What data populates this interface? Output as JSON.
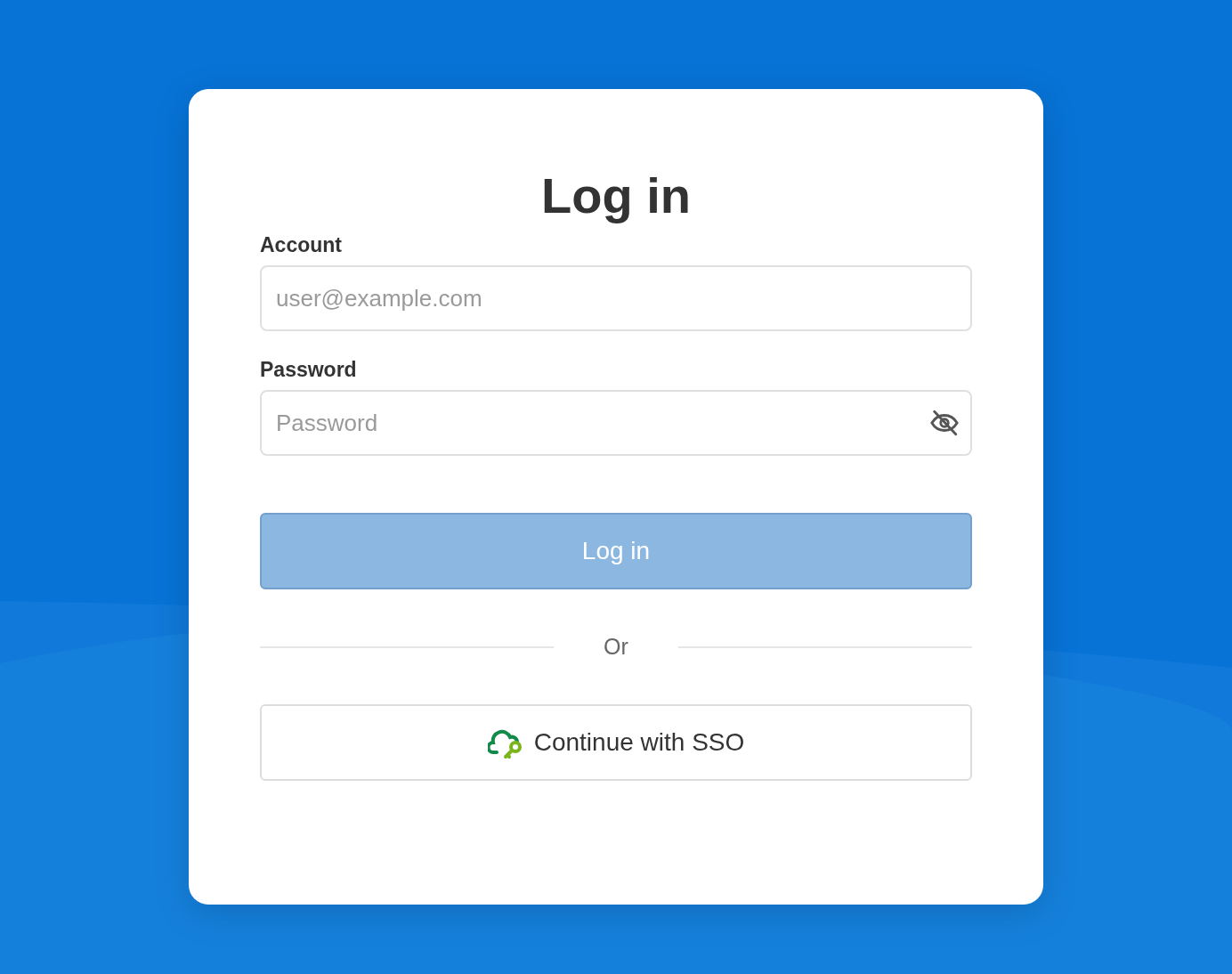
{
  "title": "Log in",
  "fields": [
    {
      "label": "Account",
      "placeholder": "user@example.com",
      "kind": "text"
    },
    {
      "label": "Password",
      "placeholder": "Password",
      "kind": "password"
    }
  ],
  "login_button": {
    "label": "Log in",
    "disabled": true
  },
  "divider": "Or",
  "sso_button": {
    "label": "Continue with SSO"
  }
}
